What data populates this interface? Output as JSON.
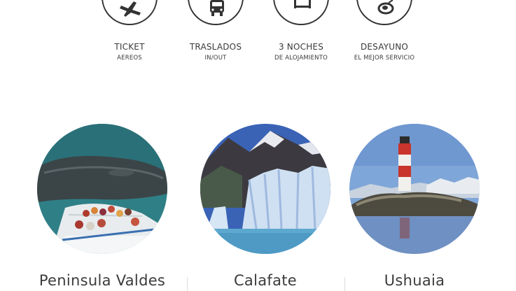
{
  "features": [
    {
      "icon": "airplane-icon",
      "title": "TICKET",
      "sub": "AEREOS"
    },
    {
      "icon": "bus-icon",
      "title": "TRASLADOS",
      "sub": "IN/OUT"
    },
    {
      "icon": "bed-icon",
      "title": "3 NOCHES",
      "sub": "DE ALOJAMIENTO"
    },
    {
      "icon": "breakfast-icon",
      "title": "DESAYUNO",
      "sub": "EL MEJOR SERVICIO"
    }
  ],
  "destinations": [
    {
      "name": "Peninsula Valdes"
    },
    {
      "name": "Calafate"
    },
    {
      "name": "Ushuaia"
    }
  ],
  "colors": {
    "ring": "#333333",
    "text": "#3b3b3b"
  }
}
